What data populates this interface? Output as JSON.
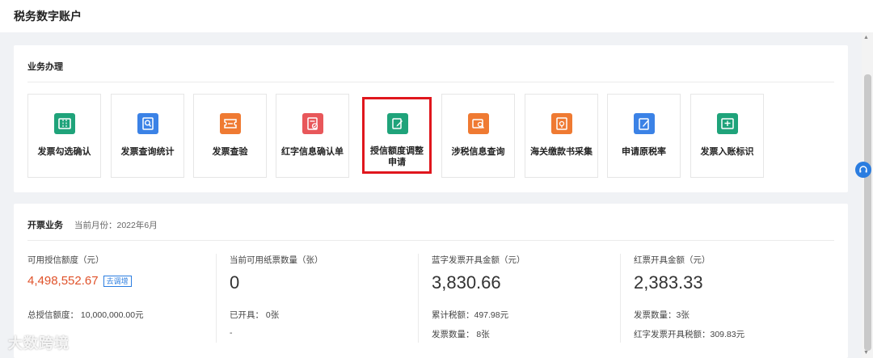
{
  "header": {
    "title": "税务数字账户"
  },
  "business": {
    "title": "业务办理",
    "tiles": [
      {
        "label": "发票勾选确认",
        "icon": "ticket-icon",
        "color": "#1fa37a"
      },
      {
        "label": "发票查询统计",
        "icon": "search-doc-icon",
        "color": "#3b82e6"
      },
      {
        "label": "发票查验",
        "icon": "inspect-ticket-icon",
        "color": "#ef7a32"
      },
      {
        "label": "红字信息确认单",
        "icon": "red-confirm-icon",
        "color": "#e8575a"
      },
      {
        "label": "授信额度调整申请",
        "icon": "edit-quota-icon",
        "color": "#1fa37a"
      },
      {
        "label": "涉税信息查询",
        "icon": "tax-search-icon",
        "color": "#ef7a32"
      },
      {
        "label": "海关缴款书采集",
        "icon": "customs-doc-icon",
        "color": "#ef7a32"
      },
      {
        "label": "申请原税率",
        "icon": "rate-apply-icon",
        "color": "#3b82e6"
      },
      {
        "label": "发票入账标识",
        "icon": "ledger-mark-icon",
        "color": "#1fa37a"
      }
    ]
  },
  "issuing": {
    "title": "开票业务",
    "month": "当前月份：2022年6月",
    "metrics": [
      {
        "label": "可用授信额度（元）",
        "value": "4,498,552.67",
        "tag": "去调增",
        "line1": "总授信额度：  10,000,000.00元",
        "line2": ""
      },
      {
        "label": "当前可用纸票数量（张）",
        "value": "0",
        "line1": "已开具：  0张",
        "line2": "-"
      },
      {
        "label": "蓝字发票开具金额（元）",
        "value": "3,830.66",
        "line1": "累计税额：497.98元",
        "line2": "发票数量：  8张"
      },
      {
        "label": "红票开具金额（元）",
        "value": "2,383.33",
        "line1": "发票数量：3张",
        "line2": "红字发票开具税额：309.83元"
      }
    ]
  },
  "watermark": "大数跨境",
  "colors": {
    "highlight": "#e0161d",
    "accent": "#2b7de0",
    "amount_red": "#e0522a"
  }
}
